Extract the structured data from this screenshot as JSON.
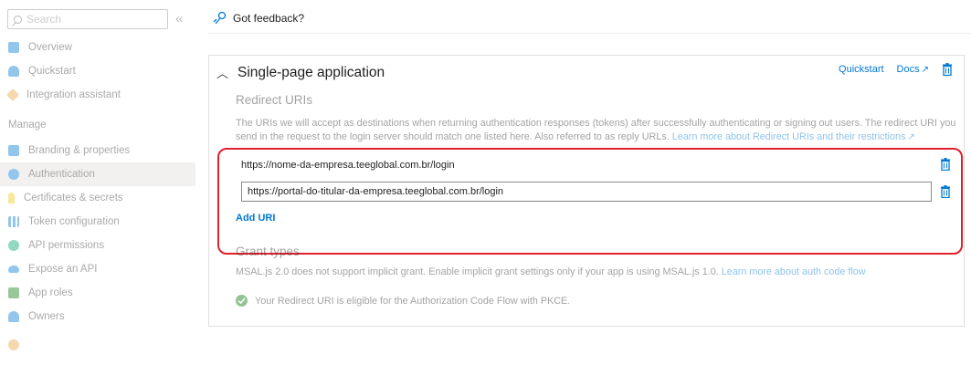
{
  "sidebar": {
    "search_placeholder": "Search",
    "collapse_glyph": "«",
    "manage_header": "Manage",
    "items": [
      {
        "label": "Overview",
        "icon": "overview-icon",
        "color": "#0078d4"
      },
      {
        "label": "Quickstart",
        "icon": "quickstart-icon",
        "color": "#0078d4"
      },
      {
        "label": "Integration assistant",
        "icon": "rocket-icon",
        "color": "#e8a33d"
      },
      {
        "label": "Branding & properties",
        "icon": "branding-icon",
        "color": "#0078d4"
      },
      {
        "label": "Authentication",
        "icon": "authentication-icon",
        "color": "#0078d4",
        "selected": true
      },
      {
        "label": "Certificates & secrets",
        "icon": "key-icon",
        "color": "#f2c811"
      },
      {
        "label": "Token configuration",
        "icon": "token-icon",
        "color": "#0078d4"
      },
      {
        "label": "API permissions",
        "icon": "api-permissions-icon",
        "color": "#00a36c"
      },
      {
        "label": "Expose an API",
        "icon": "cloud-icon",
        "color": "#0078d4"
      },
      {
        "label": "App roles",
        "icon": "app-roles-icon",
        "color": "#107c10"
      },
      {
        "label": "Owners",
        "icon": "owners-icon",
        "color": "#0078d4"
      }
    ]
  },
  "feedback": {
    "label": "Got feedback?"
  },
  "platform": {
    "title": "Single-page application",
    "quickstart_label": "Quickstart",
    "docs_label": "Docs",
    "redirect": {
      "title": "Redirect URIs",
      "description_line1": "The URIs we will accept as destinations when returning authentication responses (tokens) after successfully authenticating or signing out users. The redirect URI you",
      "description_line2": "send in the request to the login server should match one listed here. Also referred to as reply URLs.",
      "learn_more": "Learn more about Redirect URIs and their restrictions",
      "uris": [
        "https://nome-da-empresa.teeglobal.com.br/login",
        "https://portal-do-titular-da-empresa.teeglobal.com.br/login"
      ],
      "add_uri": "Add URI"
    },
    "grant": {
      "title": "Grant types",
      "description": "MSAL.js 2.0 does not support implicit grant. Enable implicit grant settings only if your app is using MSAL.js 1.0.",
      "learn_more": "Learn more about auth code flow",
      "status": "Your Redirect URI is eligible for the Authorization Code Flow with PKCE."
    }
  },
  "colors": {
    "accent": "#0078d4",
    "highlight_border": "#e0202b",
    "success": "#107c10"
  }
}
